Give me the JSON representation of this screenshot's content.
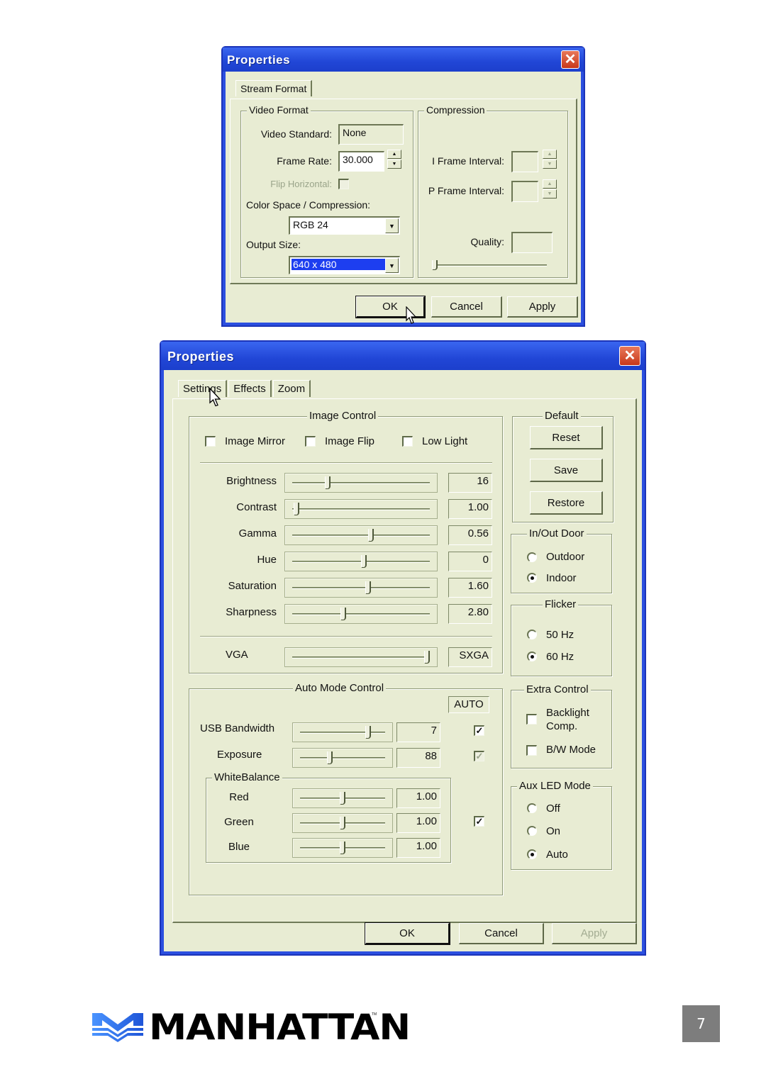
{
  "dialog1": {
    "title": "Properties",
    "tabs": [
      {
        "label": "Stream Format",
        "active": true
      }
    ],
    "video_format": {
      "group_label": "Video Format",
      "video_standard_label": "Video Standard:",
      "video_standard_value": "None",
      "frame_rate_label": "Frame Rate:",
      "frame_rate_value": "30.000",
      "flip_horizontal_label": "Flip Horizontal:",
      "flip_horizontal_checked": false,
      "color_space_label": "Color Space / Compression:",
      "color_space_value": "RGB 24",
      "output_size_label": "Output Size:",
      "output_size_value": "640 x 480"
    },
    "compression": {
      "group_label": "Compression",
      "i_frame_label": "I Frame Interval:",
      "i_frame_value": "",
      "p_frame_label": "P Frame Interval:",
      "p_frame_value": "",
      "quality_label": "Quality:",
      "quality_value": "",
      "quality_slider": 0
    },
    "buttons": {
      "ok": "OK",
      "cancel": "Cancel",
      "apply": "Apply"
    }
  },
  "dialog2": {
    "title": "Properties",
    "tabs": [
      {
        "label": "Settings",
        "active": true
      },
      {
        "label": "Effects",
        "active": false
      },
      {
        "label": "Zoom",
        "active": false
      }
    ],
    "image_control": {
      "group_label": "Image Control",
      "checkboxes": [
        {
          "label": "Image Mirror",
          "checked": false
        },
        {
          "label": "Image Flip",
          "checked": false
        },
        {
          "label": "Low Light",
          "checked": false
        }
      ],
      "sliders": [
        {
          "label": "Brightness",
          "value": "16",
          "position": 0.26
        },
        {
          "label": "Contrast",
          "value": "1.00",
          "position": 0.03
        },
        {
          "label": "Gamma",
          "value": "0.56",
          "position": 0.57
        },
        {
          "label": "Hue",
          "value": "0",
          "position": 0.52
        },
        {
          "label": "Saturation",
          "value": "1.60",
          "position": 0.55
        },
        {
          "label": "Sharpness",
          "value": "2.80",
          "position": 0.37
        }
      ],
      "resolution": {
        "left_label": "VGA",
        "value": "SXGA",
        "position": 0.98
      }
    },
    "auto_mode": {
      "group_label": "Auto Mode Control",
      "auto_header": "AUTO",
      "usb_bandwidth": {
        "label": "USB Bandwidth",
        "value": "7",
        "position": 0.8,
        "auto": true
      },
      "exposure": {
        "label": "Exposure",
        "value": "88",
        "position": 0.35,
        "auto": true,
        "auto_disabled": true
      },
      "white_balance": {
        "group_label": "WhiteBalance",
        "auto": true,
        "channels": [
          {
            "label": "Red",
            "value": "1.00",
            "position": 0.5
          },
          {
            "label": "Green",
            "value": "1.00",
            "position": 0.5
          },
          {
            "label": "Blue",
            "value": "1.00",
            "position": 0.5
          }
        ]
      }
    },
    "default": {
      "group_label": "Default",
      "reset": "Reset",
      "save": "Save",
      "restore": "Restore"
    },
    "in_out_door": {
      "group_label": "In/Out Door",
      "options": [
        {
          "label": "Outdoor",
          "selected": false
        },
        {
          "label": "Indoor",
          "selected": true
        }
      ]
    },
    "flicker": {
      "group_label": "Flicker",
      "options": [
        {
          "label": "50 Hz",
          "selected": false
        },
        {
          "label": "60 Hz",
          "selected": true
        }
      ]
    },
    "extra_control": {
      "group_label": "Extra Control",
      "backlight_line1": "Backlight",
      "backlight_line2": "Comp.",
      "backlight_checked": false,
      "bw_mode": "B/W Mode",
      "bw_checked": false
    },
    "aux_led": {
      "group_label": "Aux LED Mode",
      "options": [
        {
          "label": "Off",
          "selected": false
        },
        {
          "label": "On",
          "selected": false
        },
        {
          "label": "Auto",
          "selected": true
        }
      ]
    },
    "buttons": {
      "ok": "OK",
      "cancel": "Cancel",
      "apply": "Apply"
    }
  },
  "footer": {
    "brand": "MANHATTAN",
    "trademark": "TM",
    "page_number": "7",
    "brand_color": "#2f6fe8"
  }
}
